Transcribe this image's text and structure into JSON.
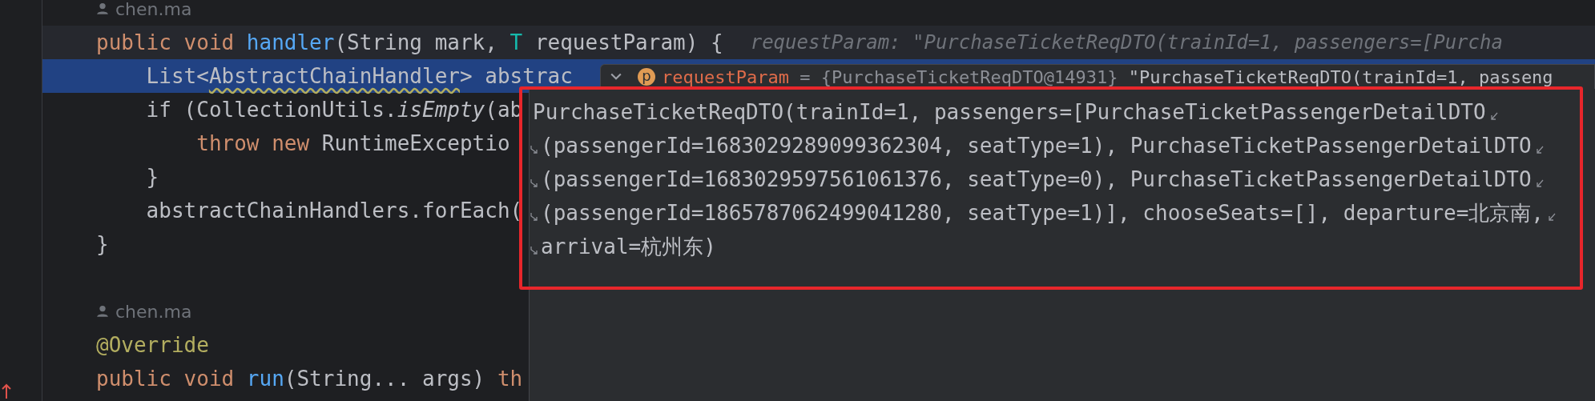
{
  "editor": {
    "lines": [
      {
        "kind": "author",
        "text": "chen.ma"
      },
      {
        "kind": "code",
        "current": true,
        "selected": false,
        "tokens": [
          {
            "text": "public void ",
            "kind": "keyword"
          },
          {
            "text": "handler",
            "kind": "method"
          },
          {
            "text": "(String mark, ",
            "kind": "plain"
          },
          {
            "text": "T",
            "kind": "type_param"
          },
          {
            "text": " requestParam) {",
            "kind": "plain"
          }
        ],
        "hint": "requestParam: \"PurchaseTicketReqDTO(trainId=1, passengers=[Purcha"
      },
      {
        "kind": "code",
        "current": false,
        "selected": true,
        "tokens": [
          {
            "text": "    List<",
            "kind": "plain"
          },
          {
            "text": "AbstractChainHandler",
            "kind": "warning"
          },
          {
            "text": "> abstrac",
            "kind": "plain"
          }
        ]
      },
      {
        "kind": "code",
        "current": false,
        "selected": false,
        "tokens": [
          {
            "text": "    if (CollectionUtils.",
            "kind": "plain"
          },
          {
            "text": "isEmpty",
            "kind": "italic"
          },
          {
            "text": "(ab",
            "kind": "plain"
          }
        ]
      },
      {
        "kind": "code",
        "current": false,
        "selected": false,
        "tokens": [
          {
            "text": "        throw new ",
            "kind": "keyword"
          },
          {
            "text": "RuntimeExceptio",
            "kind": "plain"
          }
        ]
      },
      {
        "kind": "code",
        "current": false,
        "selected": false,
        "tokens": [
          {
            "text": "    }",
            "kind": "plain"
          }
        ]
      },
      {
        "kind": "code",
        "current": false,
        "selected": false,
        "tokens": [
          {
            "text": "    abstractChainHandlers.forEach(",
            "kind": "plain"
          }
        ]
      },
      {
        "kind": "code",
        "current": false,
        "selected": false,
        "tokens": [
          {
            "text": "}",
            "kind": "plain"
          }
        ]
      },
      {
        "kind": "blank"
      },
      {
        "kind": "author",
        "text": "chen.ma"
      },
      {
        "kind": "code",
        "current": false,
        "selected": false,
        "tokens": [
          {
            "text": "@Override",
            "kind": "annotation"
          }
        ]
      },
      {
        "kind": "code",
        "current": false,
        "selected": false,
        "tokens": [
          {
            "text": "public void ",
            "kind": "keyword"
          },
          {
            "text": "run",
            "kind": "method"
          },
          {
            "text": "(String... args) ",
            "kind": "plain"
          },
          {
            "text": "th",
            "kind": "keyword"
          }
        ]
      }
    ]
  },
  "debug_popup": {
    "icon_letter": "p",
    "name": "requestParam",
    "type": " = {PurchaseTicketReqDTO@14931}",
    "value": " \"PurchaseTicketReqDTO(trainId=1, passeng"
  },
  "tooltip": {
    "lines": [
      {
        "text": "PurchaseTicketReqDTO(trainId=1, passengers=[PurchaseTicketPassengerDetailDTO",
        "continued": false,
        "wraps": true
      },
      {
        "text": "(passengerId=1683029289099362304, seatType=1), PurchaseTicketPassengerDetailDTO",
        "continued": true,
        "wraps": true
      },
      {
        "text": "(passengerId=1683029597561061376, seatType=0), PurchaseTicketPassengerDetailDTO",
        "continued": true,
        "wraps": true
      },
      {
        "text": "(passengerId=1865787062499041280, seatType=1)], chooseSeats=[], departure=北京南,",
        "continued": true,
        "wraps": true
      },
      {
        "text": "arrival=杭州东)",
        "continued": true,
        "wraps": false
      }
    ]
  }
}
